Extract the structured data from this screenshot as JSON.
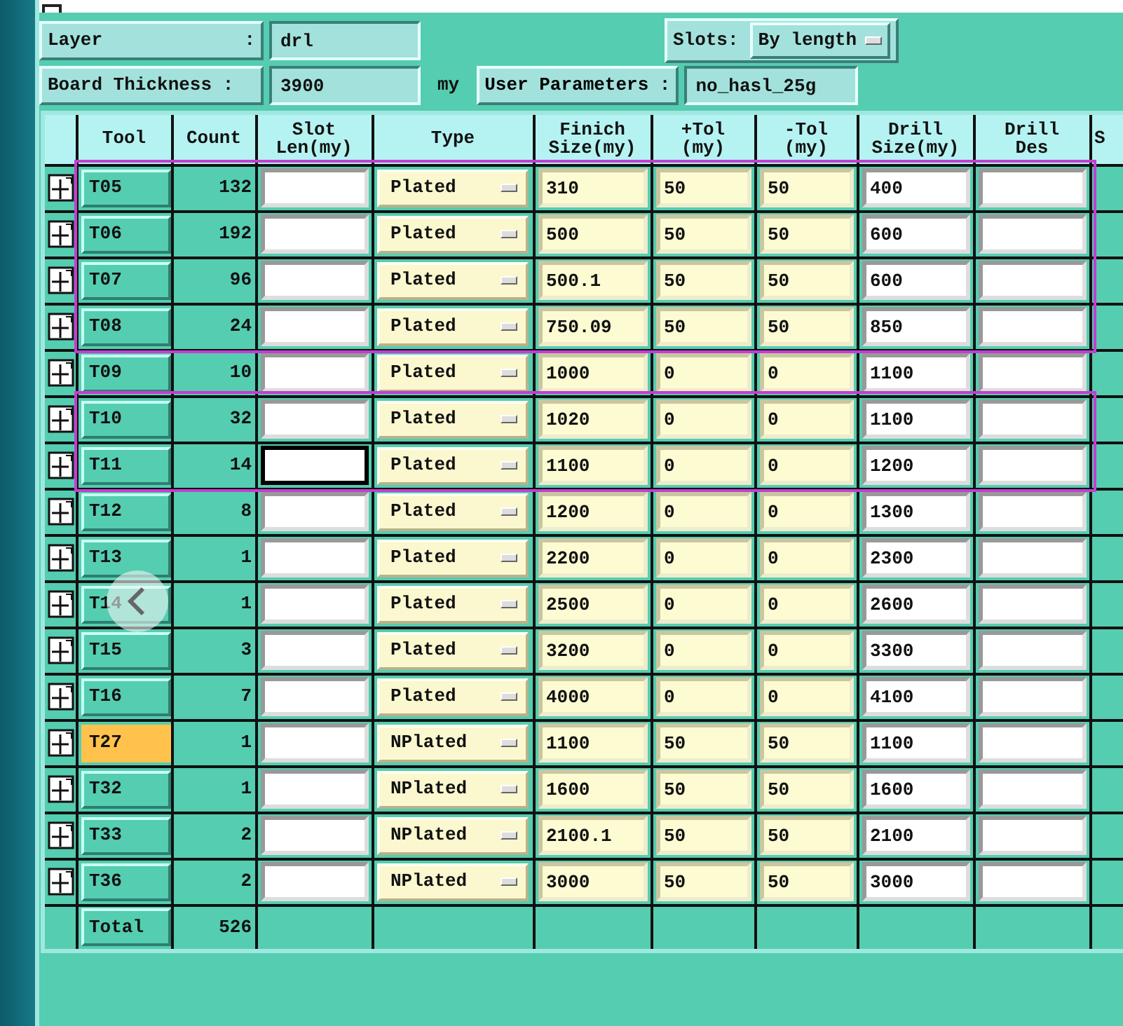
{
  "layer": {
    "label": "Layer",
    "separator": ":",
    "value": "drl"
  },
  "slots": {
    "label": "Slots:",
    "value": "By length"
  },
  "board_thickness": {
    "label": "Board Thickness :",
    "value": "3900",
    "unit": "my"
  },
  "user_parameters": {
    "label": "User Parameters :",
    "value": "no_hasl_25g"
  },
  "table": {
    "columns": [
      {
        "lines": [
          "Tool"
        ]
      },
      {
        "lines": [
          "Count"
        ]
      },
      {
        "lines": [
          "Slot",
          "Len(my)"
        ]
      },
      {
        "lines": [
          "Type"
        ]
      },
      {
        "lines": [
          "Finich",
          "Size(my)"
        ]
      },
      {
        "lines": [
          "+Tol",
          "(my)"
        ]
      },
      {
        "lines": [
          "-Tol",
          "(my)"
        ]
      },
      {
        "lines": [
          "Drill",
          "Size(my)"
        ]
      },
      {
        "lines": [
          "Drill",
          "Des"
        ]
      },
      {
        "lines": [
          "S"
        ]
      }
    ],
    "rows": [
      {
        "tool": "T05",
        "selected": false,
        "count": "132",
        "slot_focused": false,
        "type": "Plated",
        "finish_size": "310",
        "plus_tol": "50",
        "minus_tol": "50",
        "drill_size": "400",
        "highlight": true
      },
      {
        "tool": "T06",
        "selected": false,
        "count": "192",
        "slot_focused": false,
        "type": "Plated",
        "finish_size": "500",
        "plus_tol": "50",
        "minus_tol": "50",
        "drill_size": "600",
        "highlight": true
      },
      {
        "tool": "T07",
        "selected": false,
        "count": "96",
        "slot_focused": false,
        "type": "Plated",
        "finish_size": "500.1",
        "plus_tol": "50",
        "minus_tol": "50",
        "drill_size": "600",
        "highlight": true
      },
      {
        "tool": "T08",
        "selected": false,
        "count": "24",
        "slot_focused": false,
        "type": "Plated",
        "finish_size": "750.09",
        "plus_tol": "50",
        "minus_tol": "50",
        "drill_size": "850",
        "highlight": true
      },
      {
        "tool": "T09",
        "selected": false,
        "count": "10",
        "slot_focused": false,
        "type": "Plated",
        "finish_size": "1000",
        "plus_tol": "0",
        "minus_tol": "0",
        "drill_size": "1100",
        "highlight": false
      },
      {
        "tool": "T10",
        "selected": false,
        "count": "32",
        "slot_focused": false,
        "type": "Plated",
        "finish_size": "1020",
        "plus_tol": "0",
        "minus_tol": "0",
        "drill_size": "1100",
        "highlight": true
      },
      {
        "tool": "T11",
        "selected": false,
        "count": "14",
        "slot_focused": true,
        "type": "Plated",
        "finish_size": "1100",
        "plus_tol": "0",
        "minus_tol": "0",
        "drill_size": "1200",
        "highlight": true
      },
      {
        "tool": "T12",
        "selected": false,
        "count": "8",
        "slot_focused": false,
        "type": "Plated",
        "finish_size": "1200",
        "plus_tol": "0",
        "minus_tol": "0",
        "drill_size": "1300",
        "highlight": false
      },
      {
        "tool": "T13",
        "selected": false,
        "count": "1",
        "slot_focused": false,
        "type": "Plated",
        "finish_size": "2200",
        "plus_tol": "0",
        "minus_tol": "0",
        "drill_size": "2300",
        "highlight": false
      },
      {
        "tool": "T14",
        "selected": false,
        "count": "1",
        "slot_focused": false,
        "type": "Plated",
        "finish_size": "2500",
        "plus_tol": "0",
        "minus_tol": "0",
        "drill_size": "2600",
        "highlight": false
      },
      {
        "tool": "T15",
        "selected": false,
        "count": "3",
        "slot_focused": false,
        "type": "Plated",
        "finish_size": "3200",
        "plus_tol": "0",
        "minus_tol": "0",
        "drill_size": "3300",
        "highlight": false
      },
      {
        "tool": "T16",
        "selected": false,
        "count": "7",
        "slot_focused": false,
        "type": "Plated",
        "finish_size": "4000",
        "plus_tol": "0",
        "minus_tol": "0",
        "drill_size": "4100",
        "highlight": false
      },
      {
        "tool": "T27",
        "selected": true,
        "count": "1",
        "slot_focused": false,
        "type": "NPlated",
        "finish_size": "1100",
        "plus_tol": "50",
        "minus_tol": "50",
        "drill_size": "1100",
        "highlight": false
      },
      {
        "tool": "T32",
        "selected": false,
        "count": "1",
        "slot_focused": false,
        "type": "NPlated",
        "finish_size": "1600",
        "plus_tol": "50",
        "minus_tol": "50",
        "drill_size": "1600",
        "highlight": false
      },
      {
        "tool": "T33",
        "selected": false,
        "count": "2",
        "slot_focused": false,
        "type": "NPlated",
        "finish_size": "2100.1",
        "plus_tol": "50",
        "minus_tol": "50",
        "drill_size": "2100",
        "highlight": false
      },
      {
        "tool": "T36",
        "selected": false,
        "count": "2",
        "slot_focused": false,
        "type": "NPlated",
        "finish_size": "3000",
        "plus_tol": "50",
        "minus_tol": "50",
        "drill_size": "3000",
        "highlight": false
      }
    ],
    "total": {
      "label": "Total",
      "count": "526"
    }
  }
}
